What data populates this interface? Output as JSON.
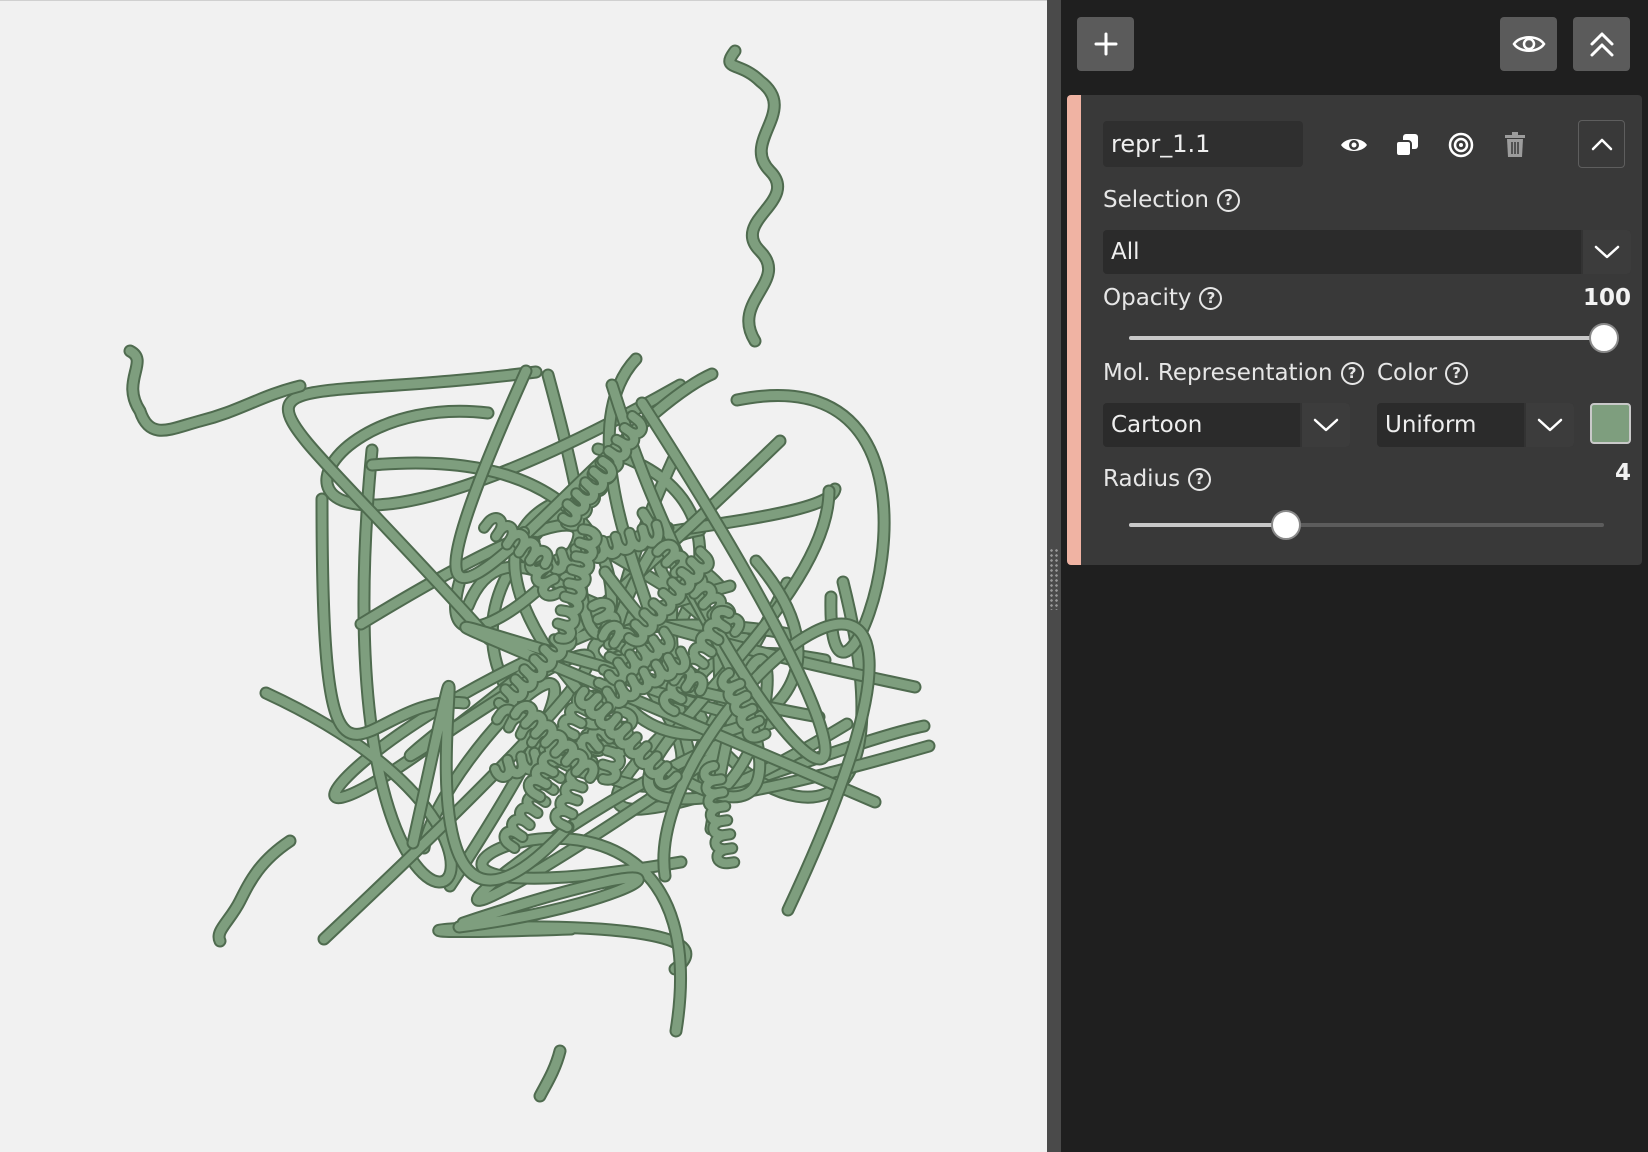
{
  "toolbar": {
    "add_icon": "plus-icon",
    "visibility_icon": "eye-icon",
    "collapse_all_icon": "double-chevron-up-icon"
  },
  "representation": {
    "name": "repr_1.1",
    "actions": [
      "eye-icon",
      "duplicate-icon",
      "target-icon",
      "trash-icon",
      "chevron-up-icon"
    ],
    "accent_color": "#f0b3a3",
    "selection": {
      "label": "Selection",
      "value": "All"
    },
    "opacity": {
      "label": "Opacity",
      "value": "100",
      "fraction": 1.0
    },
    "mol_representation": {
      "label": "Mol. Representation",
      "value": "Cartoon"
    },
    "color": {
      "label": "Color",
      "value": "Uniform",
      "swatch": "#7e9e7e"
    },
    "radius": {
      "label": "Radius",
      "value": "4",
      "fraction": 0.33
    }
  },
  "viewer": {
    "background": "#f1f1f1",
    "molecule_color": "#7e9e7e"
  }
}
